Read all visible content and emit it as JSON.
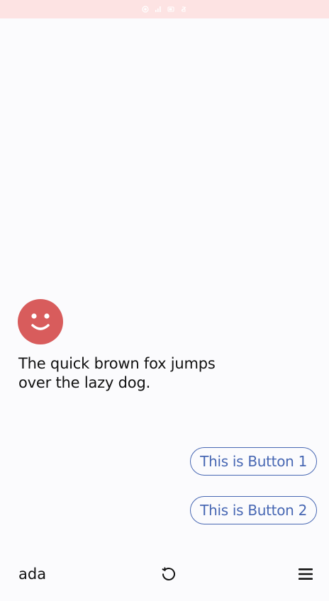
{
  "status_bar": {
    "background": "#fde3e3",
    "icons": [
      "record-icon",
      "signal-icon",
      "battery-icon",
      "rotation-lock-icon"
    ]
  },
  "avatar": {
    "icon": "smiley-face-icon",
    "color": "#d85c5c"
  },
  "message": {
    "text": "The quick brown fox jumps over the lazy dog."
  },
  "buttons": [
    {
      "label": "This is Button 1"
    },
    {
      "label": "This is Button 2"
    }
  ],
  "bottom_bar": {
    "label": "ada",
    "refresh_icon": "refresh-icon",
    "menu_icon": "hamburger-menu-icon"
  },
  "colors": {
    "accent": "#4767b3",
    "text": "#111111",
    "background": "#fbfbfd"
  }
}
